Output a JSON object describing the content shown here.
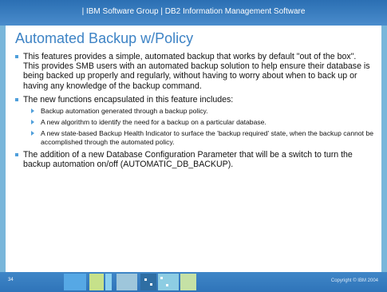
{
  "header": {
    "left": "IBM Software Group",
    "separator": "|",
    "right": "DB2 Information Management Software"
  },
  "slide": {
    "title": "Automated Backup w/Policy",
    "bullets": [
      {
        "text": "This features provides a simple, automated backup that works by default \"out of the box\".  This provides SMB users with an automated backup solution to help ensure their database is being backed up properly and regularly, without having to worry about when to back up or having any knowledge of the backup command."
      },
      {
        "text": "The new functions encapsulated in this feature includes:",
        "sub": [
          "Backup automation generated through a backup policy.",
          "A new algorithm to identify the need for a backup on a particular database.",
          "A new state-based Backup Health Indicator to surface the 'backup required' state, when the backup cannot be accomplished through the automated policy."
        ]
      },
      {
        "text": "The addition of a  new Database Configuration Parameter that will be a switch to turn the backup automation on/off (AUTOMATIC_DB_BACKUP)."
      }
    ]
  },
  "footer": {
    "page_number": "34",
    "copyright": "Copyright © IBM 2004"
  },
  "colors": {
    "header_blue": "#2b6fb3",
    "title_blue": "#3d83c5",
    "bullet_blue": "#4f9fdb",
    "frame_light_blue": "#79b6da"
  }
}
